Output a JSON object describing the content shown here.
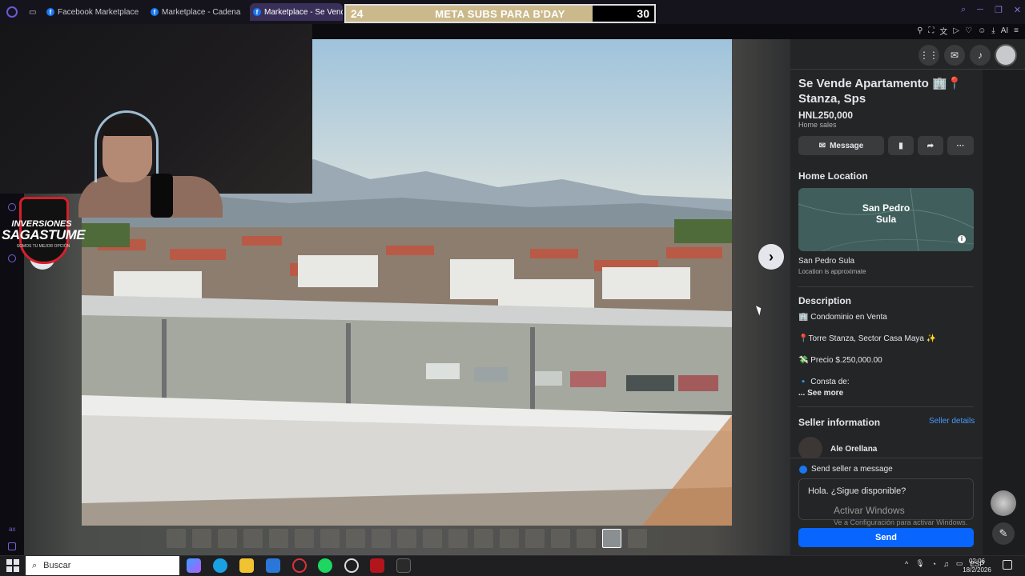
{
  "browser": {
    "tabs": [
      {
        "label": "Facebook Marketplace | Fa"
      },
      {
        "label": "Marketplace - Cadena de"
      },
      {
        "label": "Marketplace - Se Vende A"
      }
    ],
    "toolbar_ai": "AI"
  },
  "overlay": {
    "subs_current": "24",
    "subs_title": "META SUBS PARA B'DAY",
    "subs_goal": "30",
    "subs_progress": 0.8,
    "logo_line1": "INVERSIONES",
    "logo_line2": "SAGASTUME",
    "logo_line3": "SOMOS TU MEJOR OPCIÓN",
    "side_label": "ax"
  },
  "viewer": {
    "thumbnail_count": 19,
    "active_thumbnail_index": 17
  },
  "listing": {
    "title": "Se Vende Apartamento 🏢📍 Stanza, Sps",
    "price": "HNL250,000",
    "category": "Home sales",
    "message_label": "Message",
    "home_location_heading": "Home Location",
    "map_label_line1": "San Pedro",
    "map_label_line2": "Sula",
    "location_name": "San Pedro Sula",
    "location_note": "Location is approximate",
    "description_heading": "Description",
    "description_lines": [
      "🏢 Condominio en Venta",
      "📍Torre Stanza, Sector Casa Maya ✨",
      "💸 Precio $.250,000.00",
      "🔹 Consta de:"
    ],
    "see_more": "... See more",
    "seller_heading": "Seller information",
    "seller_details": "Seller details",
    "seller_name": "Ale Orellana",
    "send_message_title": "Send seller a message",
    "message_value": "Hola. ¿Sigue disponible?",
    "send_label": "Send"
  },
  "windows": {
    "activate_title": "Activar Windows",
    "activate_sub": "Ve a Configuración para activar Windows.",
    "search_placeholder": "Buscar",
    "language": "ESP",
    "time": "02:06",
    "date": "18/2/2026"
  },
  "colors": {
    "fb_blue": "#0866ff",
    "link_blue": "#4599ff",
    "panel_bg": "#242526",
    "subs_fill": "#cbb98c"
  }
}
